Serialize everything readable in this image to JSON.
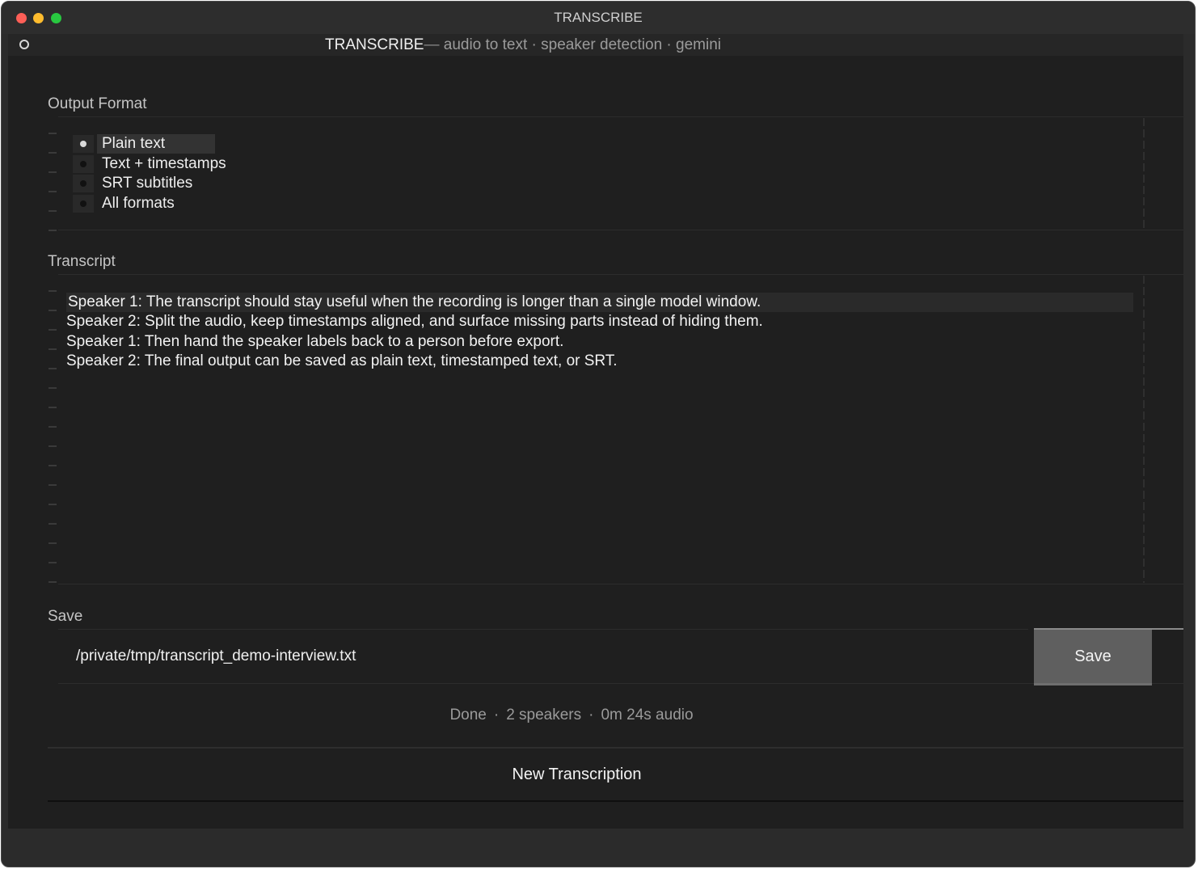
{
  "window": {
    "title": "TRANSCRIBE"
  },
  "header": {
    "brand": "TRANSCRIBE",
    "dash": "—",
    "tagline": "audio to text · speaker detection · gemini"
  },
  "output_format": {
    "label": "Output Format",
    "options": [
      {
        "label": "Plain text",
        "selected": true
      },
      {
        "label": "Text + timestamps",
        "selected": false
      },
      {
        "label": "SRT subtitles",
        "selected": false
      },
      {
        "label": "All formats",
        "selected": false
      }
    ]
  },
  "transcript": {
    "label": "Transcript",
    "lines": [
      "Speaker 1: The transcript should stay useful when the recording is longer than a single model window.",
      "Speaker 2: Split the audio, keep timestamps aligned, and surface missing parts instead of hiding them.",
      "Speaker 1: Then hand the speaker labels back to a person before export.",
      "Speaker 2: The final output can be saved as plain text, timestamped text, or SRT."
    ]
  },
  "save": {
    "label": "Save",
    "path_value": "/private/tmp/transcript_demo-interview.txt",
    "button_label": "Save"
  },
  "status": {
    "state": "Done",
    "speakers": "2 speakers",
    "duration": "0m 24s audio",
    "separator": "·"
  },
  "new_transcription_label": "New Transcription",
  "colors": {
    "background": "#1f1f1f",
    "title_bar": "#2d2d2d",
    "save_button": "#5f5f5f",
    "close": "#fe5f57",
    "minimize": "#febc2e",
    "zoom": "#28c840"
  }
}
